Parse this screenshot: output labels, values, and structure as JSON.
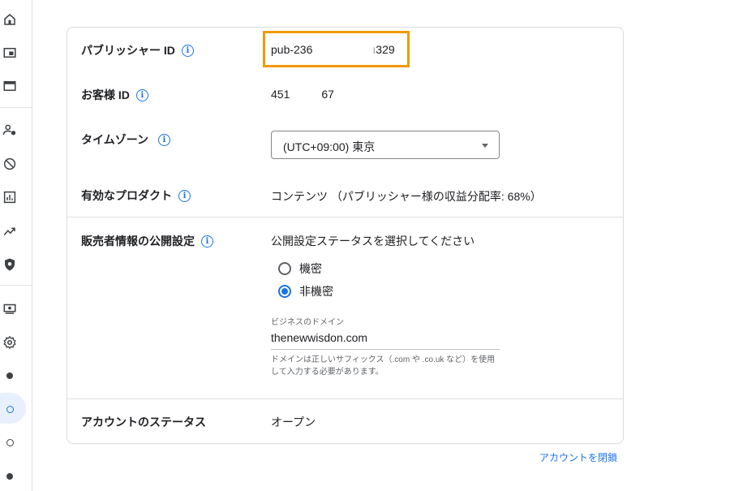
{
  "rail": {
    "items": [
      {
        "icon": "home-icon"
      },
      {
        "icon": "display-ad-icon"
      },
      {
        "icon": "browser-window-icon"
      },
      {
        "icon": "account-settings-icon"
      },
      {
        "icon": "block-icon"
      },
      {
        "icon": "reports-chart-icon"
      },
      {
        "icon": "trending-icon"
      },
      {
        "icon": "privacy-shield-icon"
      },
      {
        "icon": "payments-icon"
      },
      {
        "icon": "settings-gear-icon"
      }
    ],
    "active_color": "#e8f0fe"
  },
  "account": {
    "publisher_id": {
      "label": "パブリッシャー ID",
      "value_left": "pub-236",
      "value_right": "329",
      "highlight_color": "#f29900"
    },
    "customer_id": {
      "label": "お客様 ID",
      "value_left": "451",
      "value_right": "67"
    },
    "timezone": {
      "label": "タイムゾーン",
      "selected": "(UTC+09:00) 東京"
    },
    "products": {
      "label": "有効なプロダクト",
      "value": "コンテンツ （パブリッシャー様の収益分配率: 68%）"
    },
    "seller_info": {
      "label": "販売者情報の公開設定",
      "prompt": "公開設定ステータスを選択してください",
      "options": [
        {
          "label": "機密",
          "selected": false
        },
        {
          "label": "非機密",
          "selected": true
        }
      ],
      "domain_caption": "ビジネスのドメイン",
      "domain_value": "thenewwisdon.com",
      "domain_hint": "ドメインは正しいサフィックス（.com や .co.uk など）を使用して入力する必要があります。"
    },
    "status": {
      "label": "アカウントのステータス",
      "value": "オープン"
    },
    "close_link": "アカウントを閉鎖"
  },
  "colors": {
    "accent": "#1a73e8",
    "border": "#dadce0"
  }
}
